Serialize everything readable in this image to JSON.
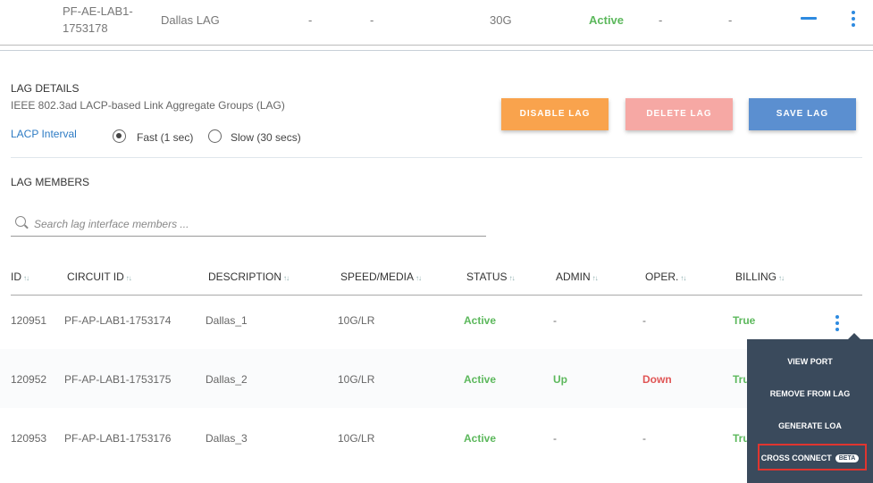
{
  "top_row": {
    "circuit_line1": "PF-AE-LAB1-",
    "circuit_line2": "1753178",
    "description": "Dallas LAG",
    "dash1": "-",
    "dash2": "-",
    "speed": "30G",
    "status": "Active",
    "dash3": "-",
    "dash4": "-"
  },
  "lag_details": {
    "title": "LAG DETAILS",
    "subtitle": "IEEE 802.3ad LACP-based Link Aggregate Groups (LAG)",
    "lacp_label": "LACP Interval",
    "options": [
      {
        "label": "Fast (1 sec)",
        "checked": true
      },
      {
        "label": "Slow (30 secs)",
        "checked": false
      }
    ]
  },
  "buttons": {
    "disable": "DISABLE LAG",
    "delete": "DELETE LAG",
    "save": "SAVE LAG"
  },
  "lag_members": {
    "title": "LAG MEMBERS",
    "search_placeholder": "Search lag interface members ..."
  },
  "table": {
    "headers": [
      "ID",
      "CIRCUIT ID",
      "DESCRIPTION",
      "SPEED/MEDIA",
      "STATUS",
      "ADMIN",
      "OPER.",
      "BILLING"
    ],
    "sort_glyph": "↑↓",
    "rows": [
      {
        "id": "120951",
        "circuit": "PF-AP-LAB1-1753174",
        "description": "Dallas_1",
        "speed": "10G/LR",
        "status": "Active",
        "admin": "-",
        "oper": "-",
        "billing": "True"
      },
      {
        "id": "120952",
        "circuit": "PF-AP-LAB1-1753175",
        "description": "Dallas_2",
        "speed": "10G/LR",
        "status": "Active",
        "admin": "Up",
        "oper": "Down",
        "billing": "Tru"
      },
      {
        "id": "120953",
        "circuit": "PF-AP-LAB1-1753176",
        "description": "Dallas_3",
        "speed": "10G/LR",
        "status": "Active",
        "admin": "-",
        "oper": "-",
        "billing": "Tru"
      }
    ]
  },
  "context_menu": {
    "items": [
      "VIEW PORT",
      "REMOVE FROM LAG",
      "GENERATE LOA",
      "CROSS CONNECT"
    ],
    "badge": "BETA"
  },
  "colors": {
    "active_green": "#5cb85c",
    "down_red": "#e05555",
    "disable_orange": "#f9a34d",
    "delete_pink": "#f6a8a4",
    "save_blue": "#5b8fd0",
    "menu_bg": "#3a4a5c",
    "highlight_red": "#e0352f"
  }
}
